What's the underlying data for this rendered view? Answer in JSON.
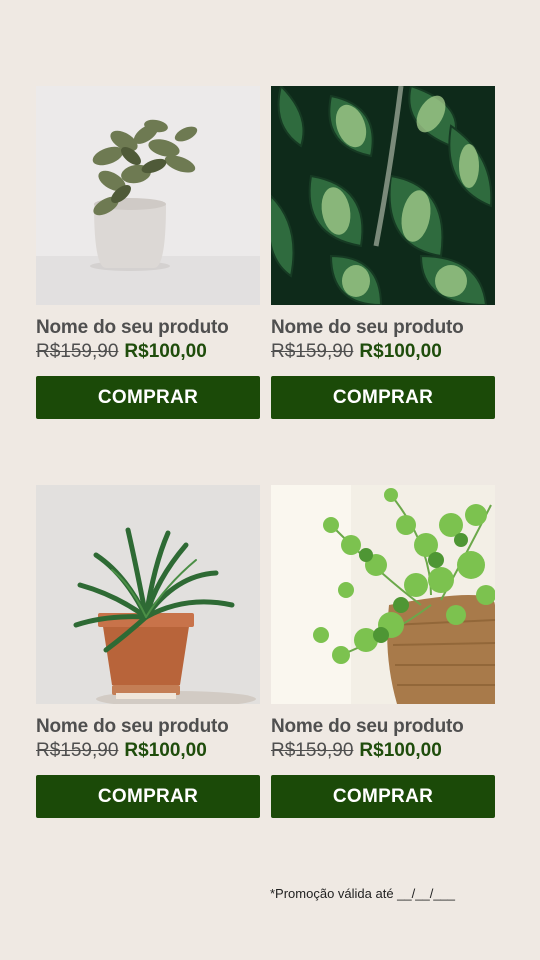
{
  "products": [
    {
      "name": "Nome do seu produto",
      "old_price": "R$159,90",
      "new_price": "R$100,00",
      "button": "COMPRAR",
      "image": "potted-succulent-white-pot"
    },
    {
      "name": "Nome do seu produto",
      "old_price": "R$159,90",
      "new_price": "R$100,00",
      "button": "COMPRAR",
      "image": "dieffenbachia-leaves"
    },
    {
      "name": "Nome do seu produto",
      "old_price": "R$159,90",
      "new_price": "R$100,00",
      "button": "COMPRAR",
      "image": "palm-terracotta-pot"
    },
    {
      "name": "Nome do seu produto",
      "old_price": "R$159,90",
      "new_price": "R$100,00",
      "button": "COMPRAR",
      "image": "pilea-wicker-basket"
    }
  ],
  "footer": {
    "note": "*Promoção válida até __/__/___"
  },
  "colors": {
    "background": "#efe9e3",
    "button": "#1b4a08",
    "new_price": "#1f4d0c",
    "text": "#4f4f4f"
  }
}
